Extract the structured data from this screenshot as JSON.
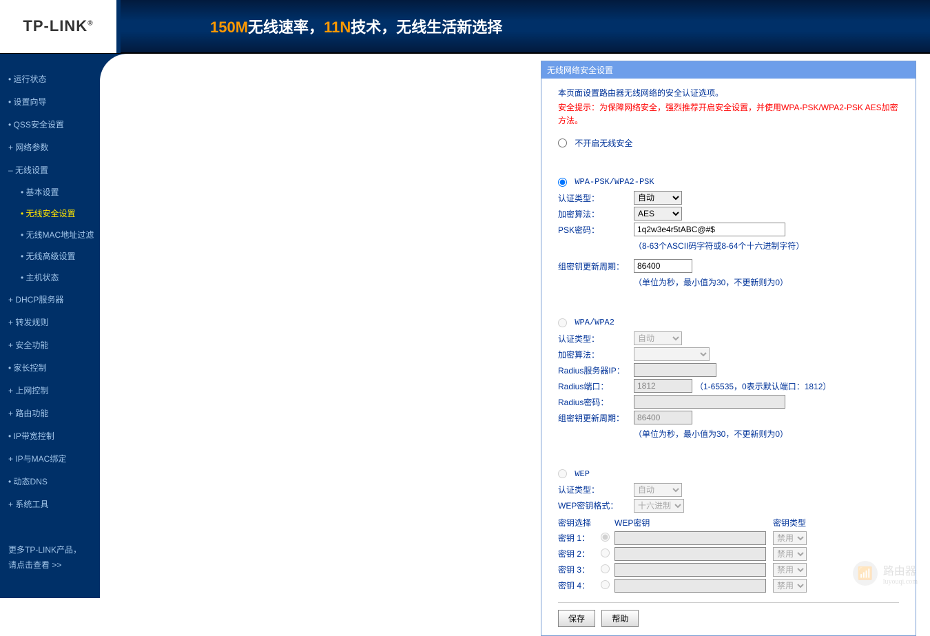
{
  "header": {
    "logo": "TP-LINK",
    "banner_speed": "150M",
    "banner_speed_suffix": "无线速率，",
    "banner_tech": "11N",
    "banner_tech_suffix": "技术，无线生活新选择"
  },
  "sidebar": {
    "items": [
      {
        "label": "运行状态",
        "type": "item"
      },
      {
        "label": "设置向导",
        "type": "item"
      },
      {
        "label": "QSS安全设置",
        "type": "item"
      },
      {
        "label": "网络参数",
        "type": "expandable"
      },
      {
        "label": "无线设置",
        "type": "expanded"
      },
      {
        "label": "DHCP服务器",
        "type": "expandable"
      },
      {
        "label": "转发规则",
        "type": "expandable"
      },
      {
        "label": "安全功能",
        "type": "expandable"
      },
      {
        "label": "家长控制",
        "type": "item"
      },
      {
        "label": "上网控制",
        "type": "expandable"
      },
      {
        "label": "路由功能",
        "type": "expandable"
      },
      {
        "label": "IP带宽控制",
        "type": "item"
      },
      {
        "label": "IP与MAC绑定",
        "type": "expandable"
      },
      {
        "label": "动态DNS",
        "type": "item"
      },
      {
        "label": "系统工具",
        "type": "expandable"
      }
    ],
    "subitems": [
      {
        "label": "基本设置"
      },
      {
        "label": "无线安全设置",
        "active": true
      },
      {
        "label": "无线MAC地址过滤"
      },
      {
        "label": "无线高级设置"
      },
      {
        "label": "主机状态"
      }
    ],
    "more_line1": "更多TP-LINK产品，",
    "more_line2": "请点击查看 >>"
  },
  "panel": {
    "title": "无线网络安全设置",
    "desc": "本页面设置路由器无线网络的安全认证选项。",
    "warning": "安全提示：为保障网络安全，强烈推荐开启安全设置，并使用WPA-PSK/WPA2-PSK AES加密方法。",
    "opt_disable": "不开启无线安全",
    "opt_wpapsk": "WPA-PSK/WPA2-PSK",
    "opt_wpa": "WPA/WPA2",
    "opt_wep": "WEP",
    "wpapsk": {
      "auth_label": "认证类型：",
      "auth_value": "自动",
      "enc_label": "加密算法：",
      "enc_value": "AES",
      "psk_label": "PSK密码：",
      "psk_value": "1q2w3e4r5tABC@#$",
      "psk_hint": "（8-63个ASCII码字符或8-64个十六进制字符）",
      "gk_label": "组密钥更新周期：",
      "gk_value": "86400",
      "gk_hint": "（单位为秒，最小值为30，不更新则为0）"
    },
    "wpa": {
      "auth_label": "认证类型：",
      "auth_value": "自动",
      "enc_label": "加密算法：",
      "enc_value": "",
      "radius_ip_label": "Radius服务器IP：",
      "radius_ip_value": "",
      "radius_port_label": "Radius端口：",
      "radius_port_value": "1812",
      "radius_port_hint": "（1-65535，0表示默认端口：1812）",
      "radius_pwd_label": "Radius密码：",
      "radius_pwd_value": "",
      "gk_label": "组密钥更新周期：",
      "gk_value": "86400",
      "gk_hint": "（单位为秒，最小值为30，不更新则为0）"
    },
    "wep": {
      "auth_label": "认证类型：",
      "auth_value": "自动",
      "fmt_label": "WEP密钥格式：",
      "fmt_value": "十六进制",
      "col_select": "密钥选择",
      "col_key": "WEP密钥",
      "col_type": "密钥类型",
      "rows": [
        {
          "label": "密钥 1：",
          "type": "禁用"
        },
        {
          "label": "密钥 2：",
          "type": "禁用"
        },
        {
          "label": "密钥 3：",
          "type": "禁用"
        },
        {
          "label": "密钥 4：",
          "type": "禁用"
        }
      ]
    },
    "btn_save": "保存",
    "btn_help": "帮助"
  },
  "watermark": {
    "text": "路由器",
    "sub": "luyouqi.com"
  }
}
